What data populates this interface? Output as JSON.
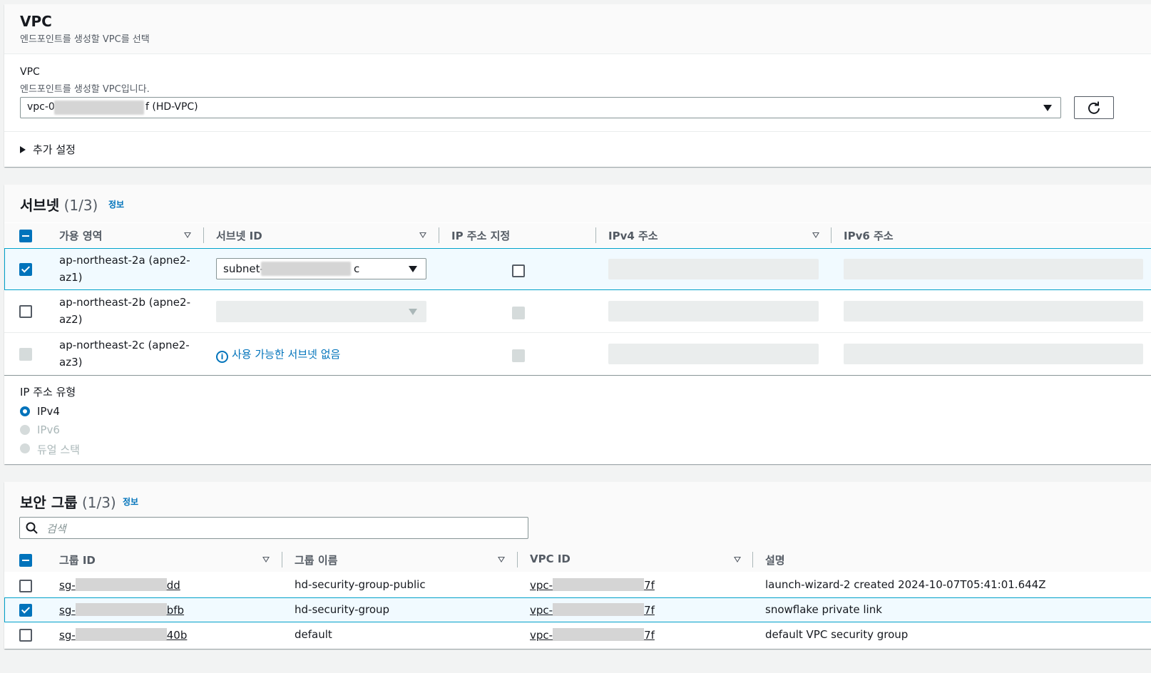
{
  "vpc_section": {
    "title": "VPC",
    "subtitle": "엔드포인트를 생성할 VPC를 선택",
    "field_label": "VPC",
    "field_desc": "엔드포인트를 생성할 VPC입니다.",
    "select_prefix": "vpc-0",
    "select_suffix": "f (HD-VPC)",
    "additional_settings": "추가 설정"
  },
  "subnet_section": {
    "title": "서브넷",
    "count": "(1/3)",
    "info": "정보",
    "columns": [
      "가용 영역",
      "서브넷 ID",
      "IP 주소 지정",
      "IPv4 주소",
      "IPv6 주소"
    ],
    "rows": [
      {
        "az_line1": "ap-northeast-2a (apne2-",
        "az_line2": "az1)",
        "subnet_prefix": "subnet-",
        "subnet_suffix": "c",
        "checked": true
      },
      {
        "az_line1": "ap-northeast-2b (apne2-",
        "az_line2": "az2)",
        "checked": false
      },
      {
        "az_line1": "ap-northeast-2c (apne2-",
        "az_line2": "az3)",
        "no_subnet": "사용 가능한 서브넷 없음",
        "checked": false
      }
    ],
    "ip_type_label": "IP 주소 유형",
    "ip_options": [
      "IPv4",
      "IPv6",
      "듀얼 스택"
    ],
    "ip_selected": "IPv4"
  },
  "sg_section": {
    "title": "보안 그룹",
    "count": "(1/3)",
    "info": "정보",
    "search_placeholder": "검색",
    "columns": [
      "그룹 ID",
      "그룹 이름",
      "VPC ID",
      "설명"
    ],
    "rows": [
      {
        "gid_prefix": "sg-",
        "gid_suffix": "dd",
        "name": "hd-security-group-public",
        "vpc_prefix": "vpc-",
        "vpc_suffix": "7f",
        "desc": "launch-wizard-2 created 2024-10-07T05:41:01.644Z",
        "checked": false
      },
      {
        "gid_prefix": "sg-",
        "gid_suffix": "bfb",
        "name": "hd-security-group",
        "vpc_prefix": "vpc-",
        "vpc_suffix": "7f",
        "desc": "snowflake private link",
        "checked": true
      },
      {
        "gid_prefix": "sg-",
        "gid_suffix": "40b",
        "name": "default",
        "vpc_prefix": "vpc-",
        "vpc_suffix": "7f",
        "desc": "default VPC security group",
        "checked": false
      }
    ]
  }
}
